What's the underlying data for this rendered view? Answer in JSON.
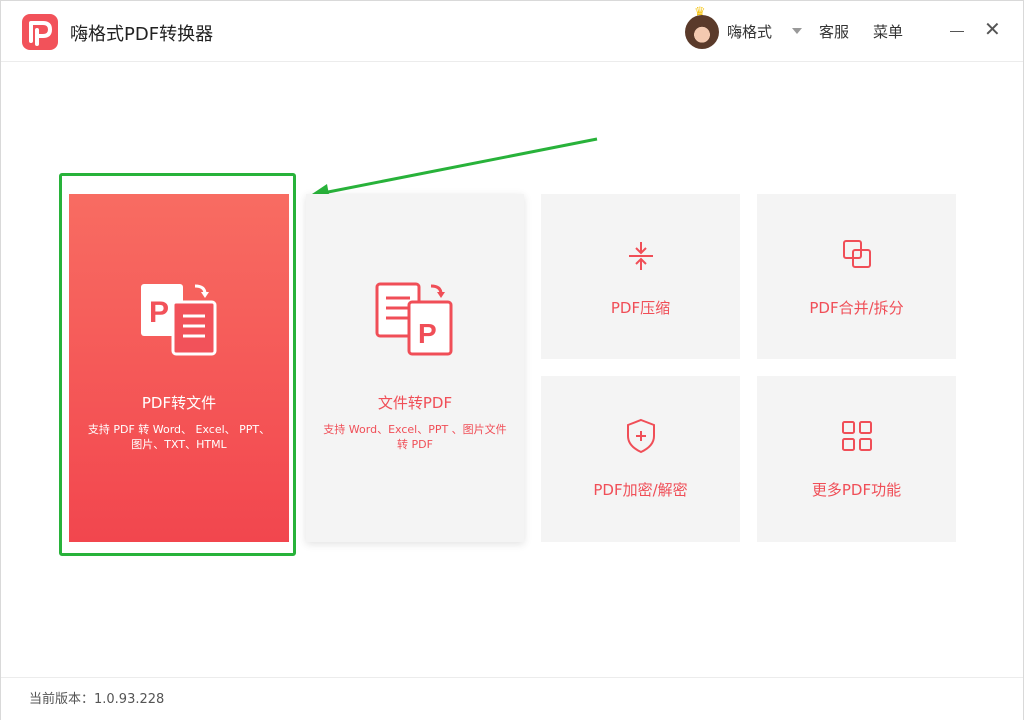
{
  "app": {
    "title": "嗨格式PDF转换器"
  },
  "header": {
    "username": "嗨格式",
    "service_label": "客服",
    "menu_label": "菜单"
  },
  "cards": {
    "pdf_to_file": {
      "label": "PDF转文件",
      "desc": "支持 PDF 转 Word、 Excel、 PPT、图片、TXT、HTML"
    },
    "file_to_pdf": {
      "label": "文件转PDF",
      "desc": "支持 Word、Excel、PPT 、图片文件转 PDF"
    },
    "compress": {
      "label": "PDF压缩"
    },
    "merge_split": {
      "label": "PDF合并/拆分"
    },
    "encrypt": {
      "label": "PDF加密/解密"
    },
    "more": {
      "label": "更多PDF功能"
    }
  },
  "footer": {
    "version": "当前版本：1.0.93.228"
  },
  "colors": {
    "accent": "#f04e57",
    "highlight": "#28b23a",
    "card_bg": "#f4f4f4"
  }
}
